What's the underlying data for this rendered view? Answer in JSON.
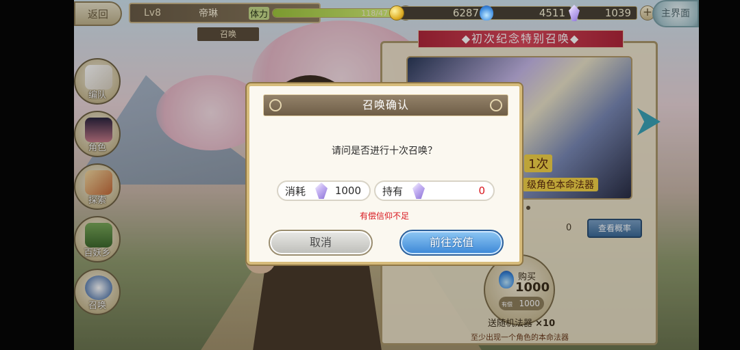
{
  "topbar": {
    "back_label": "返回",
    "level": "Lv8",
    "player_name": "帝琳",
    "stamina_label": "体力",
    "stamina_value": "118/47",
    "stamina_fraction": 1.0,
    "gold": "6287",
    "soul_fire": "4511",
    "crystal": "1039",
    "home_label": "主界面",
    "page_tag": "召唤"
  },
  "sidemenu": {
    "items": [
      {
        "label": "编队",
        "icon": "team-icon"
      },
      {
        "label": "角色",
        "icon": "character-icon"
      },
      {
        "label": "探索",
        "icon": "explore-icon"
      },
      {
        "label": "百妖乡",
        "icon": "village-icon"
      },
      {
        "label": "召唤",
        "icon": "summon-icon"
      }
    ]
  },
  "banner": {
    "title": "◆初次纪念特别召唤◆",
    "art_tag1": "1次",
    "art_tag2": "级角色本命法器",
    "count": "0",
    "rate_button": "查看概率"
  },
  "buy": {
    "label": "购买",
    "amount": "1000",
    "sub_tag": "有偿",
    "sub_amount": "1000",
    "bonus_text": "送随机法器",
    "bonus_mult": "×10",
    "note": "至少出现一个角色的本命法器"
  },
  "dialog": {
    "title": "召唤确认",
    "question": "请问是否进行十次召唤？",
    "cost_label": "消耗",
    "cost_value": "1000",
    "hold_label": "持有",
    "hold_value": "0",
    "warning": "有偿信仰不足",
    "cancel_label": "取消",
    "go_label": "前往充值"
  },
  "colors": {
    "warning": "#d8161e",
    "confirm": "#3a86d6",
    "frame": "#d6bb7a"
  }
}
